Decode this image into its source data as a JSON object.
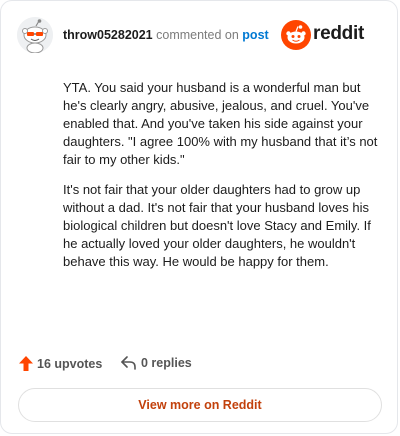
{
  "header": {
    "username": "throw05282021",
    "commented_on": "commented on",
    "post_link": "post",
    "brand": "reddit",
    "brand_color": "#ff4500"
  },
  "comment": {
    "paragraphs": [
      "YTA. You said your husband is a wonderful man but he's clearly angry, abusive, jealous, and cruel. You've enabled that. And you've taken his side against your daughters. \"I agree 100% with my husband that it’s not fair to my other kids.\"",
      "It's not fair that your older daughters had to grow up without a dad. It's not fair that your husband loves his biological children but doesn't love Stacy and Emily. If he actually loved your older daughters, he wouldn't behave this way. He would be happy for them."
    ]
  },
  "actions": {
    "upvotes": "16 upvotes",
    "replies": "0 replies"
  },
  "footer": {
    "view_more": "View more on Reddit"
  },
  "icons": {
    "avatar": "snoo-avatar-icon",
    "brand": "reddit-logo-icon",
    "upvote": "upvote-arrow-icon",
    "reply": "reply-arrow-icon"
  },
  "colors": {
    "accent_orange": "#ff4500",
    "view_more_text": "#c2410c",
    "link_blue": "#0079d3"
  }
}
